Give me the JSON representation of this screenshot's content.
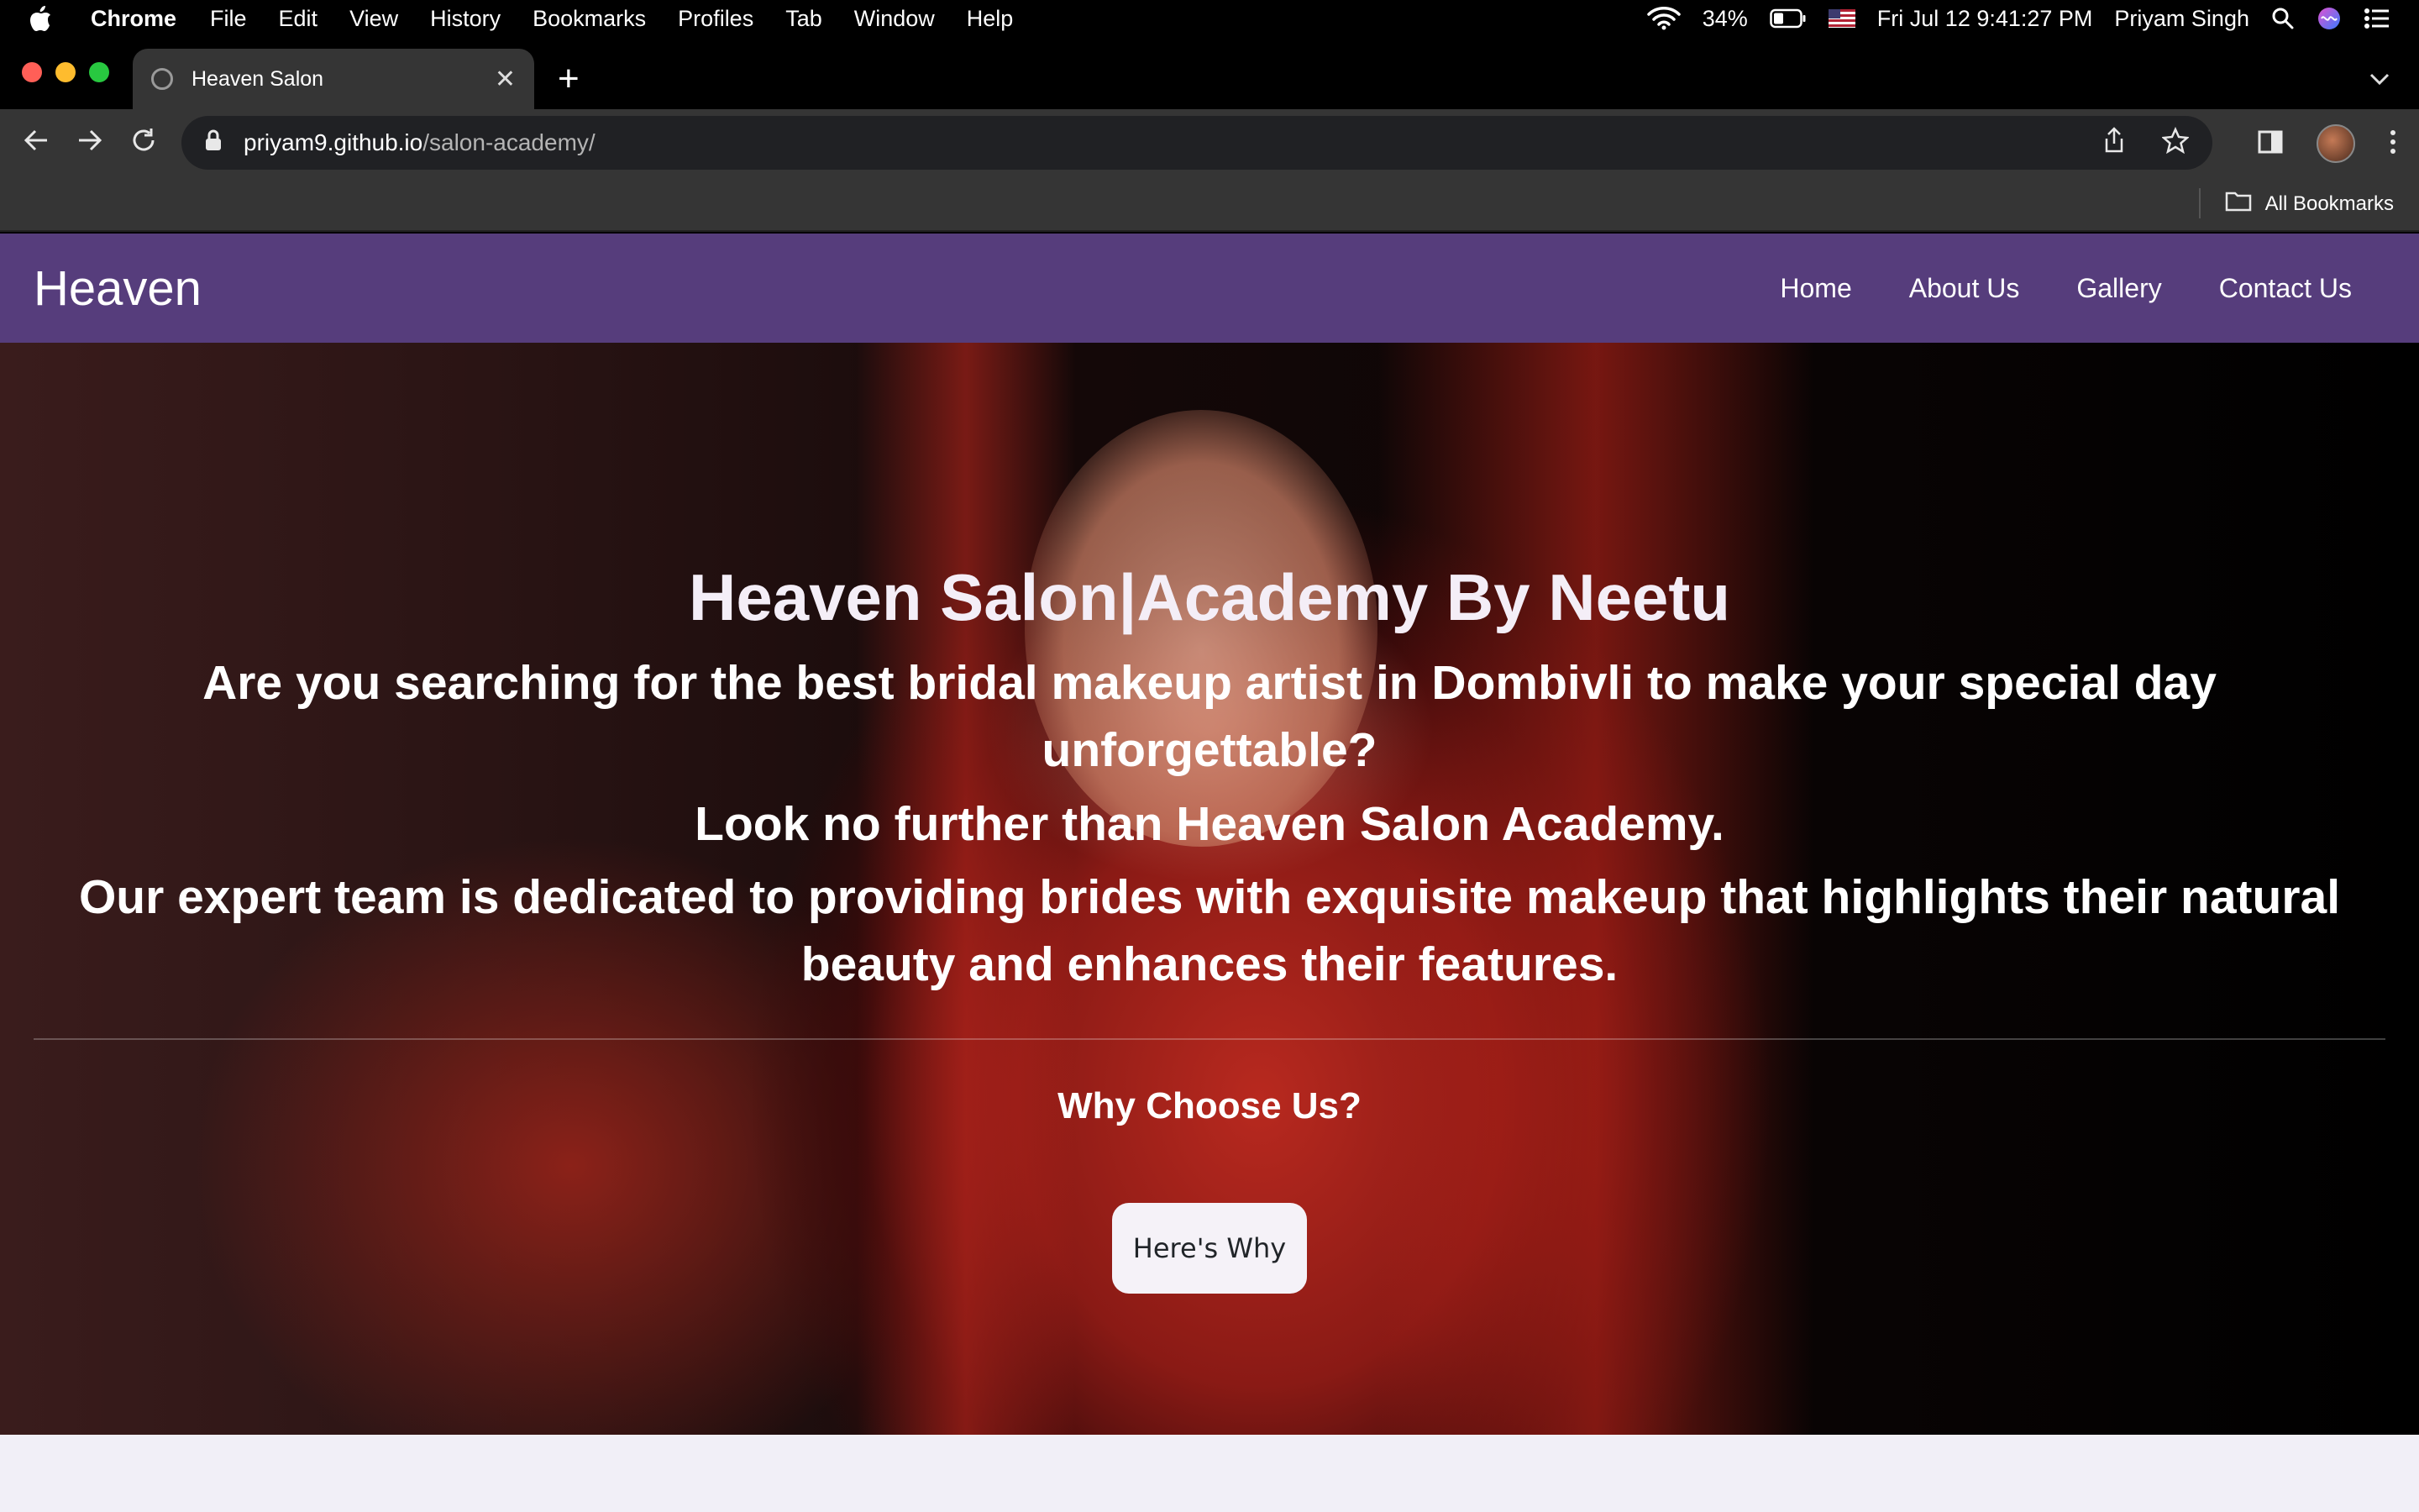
{
  "menubar": {
    "app_name": "Chrome",
    "items": [
      "File",
      "Edit",
      "View",
      "History",
      "Bookmarks",
      "Profiles",
      "Tab",
      "Window",
      "Help"
    ],
    "battery": "34%",
    "datetime": "Fri Jul 12  9:41:27 PM",
    "user": "Priyam Singh"
  },
  "browser": {
    "tab_title": "Heaven Salon",
    "url_host": "priyam9.github.io",
    "url_path": "/salon-academy/",
    "bookmarks_label": "All Bookmarks"
  },
  "site": {
    "brand": "Heaven",
    "nav": [
      "Home",
      "About Us",
      "Gallery",
      "Contact Us"
    ]
  },
  "hero": {
    "title": "Heaven Salon|Academy By Neetu",
    "lede": "Are you searching for the best bridal makeup artist in Dombivli to make your special day unforgettable?",
    "lede2": "Look no further than Heaven Salon Academy.",
    "lede3": "Our expert team is dedicated to providing brides with exquisite makeup that highlights their natural beauty and enhances their features.",
    "subheading": "Why Choose Us?",
    "button_label": "Here's Why"
  },
  "colors": {
    "navbar": "#563d7c",
    "button_bg": "#f5f2f8",
    "page_bg": "#f1eff7"
  }
}
